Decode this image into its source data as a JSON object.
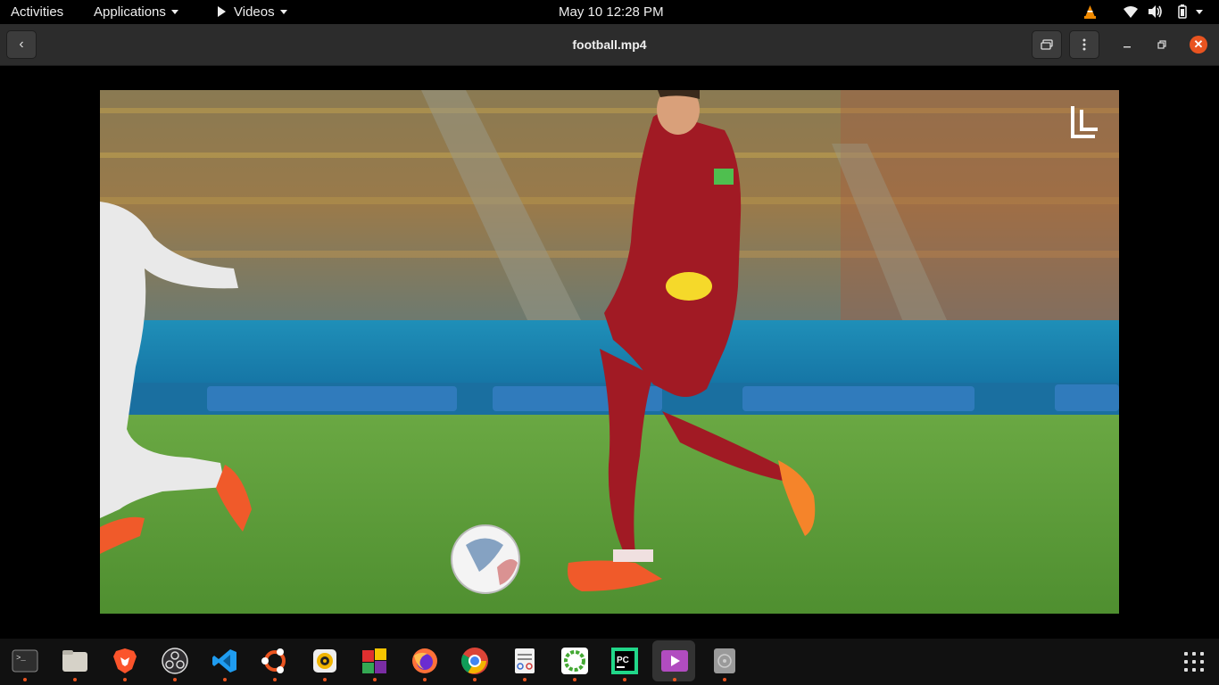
{
  "topbar": {
    "activities": "Activities",
    "applications": "Applications",
    "app_menu": "Videos",
    "clock": "May 10  12:28 PM"
  },
  "window": {
    "title": "football.mp4"
  },
  "video": {
    "watermark": "LL"
  },
  "dock": {
    "items": [
      "terminal",
      "files",
      "brave",
      "obs",
      "vscode",
      "ubuntu-software",
      "rhythmbox",
      "libreoffice",
      "firefox",
      "chrome",
      "text-editor",
      "anaconda",
      "pycharm",
      "videos",
      "disks"
    ],
    "running": [
      "terminal",
      "files",
      "brave",
      "obs",
      "vscode",
      "ubuntu-software",
      "rhythmbox",
      "libreoffice",
      "firefox",
      "chrome",
      "text-editor",
      "anaconda",
      "pycharm",
      "videos",
      "disks"
    ],
    "active": "videos"
  },
  "colors": {
    "accent": "#e95420",
    "headerbar": "#2c2c2c",
    "pitch": "#5a9a3a",
    "jersey": "#a11a24"
  }
}
